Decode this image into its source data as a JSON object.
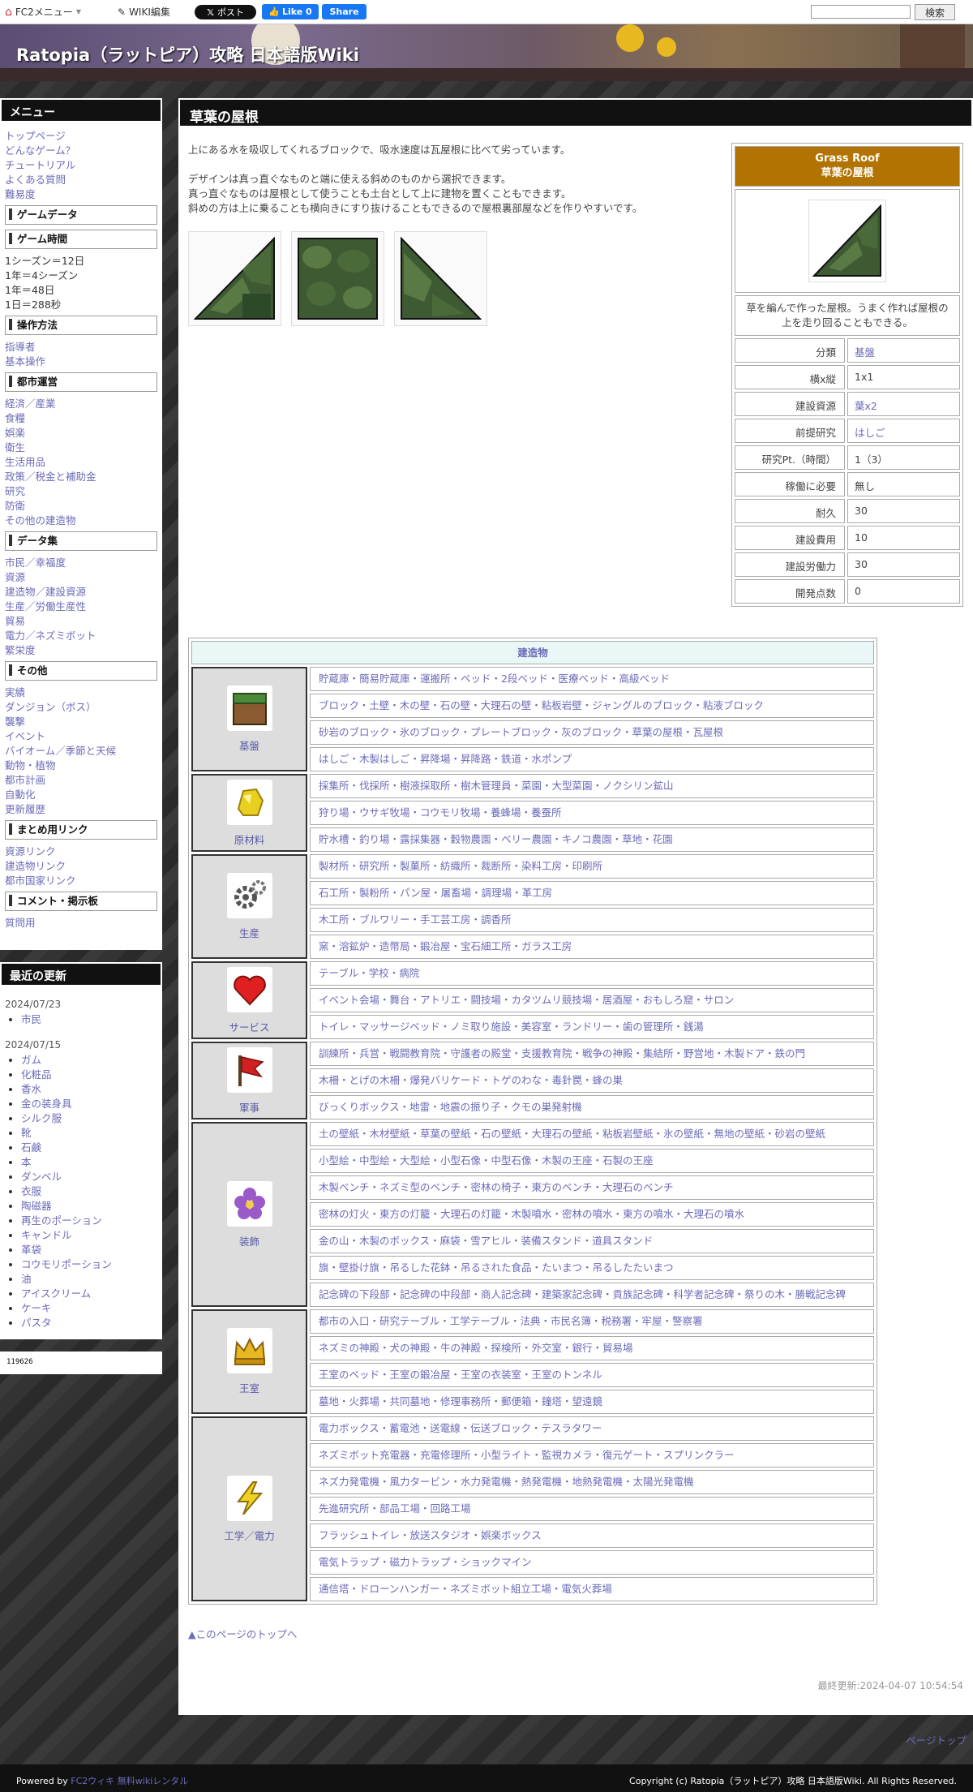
{
  "topbar": {
    "fc2_menu": "FC2メニュー",
    "wiki_edit": "WIKI編集",
    "x_post": "ポスト",
    "fb_like": "Like 0",
    "fb_share": "Share",
    "search_placeholder": "",
    "search_button": "検索"
  },
  "site": {
    "title": "Ratopia（ラットピア）攻略 日本語版Wiki"
  },
  "menu": {
    "title": "メニュー",
    "top_links": [
      "トップページ",
      "どんなゲーム？",
      "チュートリアル",
      "よくある質問",
      "難易度"
    ],
    "sections": [
      {
        "title": "ゲームデータ",
        "items": []
      },
      {
        "title": "ゲーム時間",
        "plain": [
          "1シーズン＝12日",
          "1年＝4シーズン",
          "1年＝48日",
          "1日＝288秒"
        ]
      },
      {
        "title": "操作方法",
        "items": [
          "指導者",
          "基本操作"
        ]
      },
      {
        "title": "都市運営",
        "items": [
          "経済／産業",
          "食糧",
          "娯楽",
          "衛生",
          "生活用品",
          "政策／税金と補助金",
          "研究",
          "防衛",
          "その他の建造物"
        ]
      },
      {
        "title": "データ集",
        "items": [
          "市民／幸福度",
          "資源",
          "建造物／建設資源",
          "生産／労働生産性",
          "貿易",
          "電力／ネズミボット",
          "繁栄度"
        ]
      },
      {
        "title": "その他",
        "items": [
          "実績",
          "ダンジョン（ボス）",
          "襲撃",
          "イベント",
          "バイオーム／季節と天候",
          "動物・植物",
          "都市計画",
          "自動化",
          "更新履歴"
        ]
      },
      {
        "title": "まとめ用リンク",
        "items": [
          "資源リンク",
          "建造物リンク",
          "都市国家リンク"
        ]
      },
      {
        "title": "コメント・掲示板",
        "items": [
          "質問用"
        ]
      }
    ]
  },
  "recent": {
    "title": "最近の更新",
    "groups": [
      {
        "date": "2024/07/23",
        "items": [
          "市民"
        ]
      },
      {
        "date": "2024/07/15",
        "items": [
          "ガム",
          "化粧品",
          "香水",
          "金の装身具",
          "シルク服",
          "靴",
          "石鹸",
          "本",
          "ダンベル",
          "衣服",
          "陶磁器",
          "再生のポーション",
          "キャンドル",
          "革袋",
          "コウモリポーション",
          "油",
          "アイスクリーム",
          "ケーキ",
          "パスタ"
        ]
      }
    ]
  },
  "counter": "119626",
  "page": {
    "title": "草葉の屋根",
    "intro": [
      "上にある水を吸収してくれるブロックで、吸水速度は瓦屋根に比べて劣っています。",
      "デザインは真っ直ぐなものと端に使える斜めのものから選択できます。",
      "真っ直ぐなものは屋根として使うことも土台として上に建物を置くこともできます。",
      "斜めの方は上に乗ることも横向きにすり抜けることもできるので屋根裏部屋などを作りやすいです。"
    ],
    "to_top": "▲このページのトップへ",
    "last_updated": "最終更新:2024-04-07 10:54:54"
  },
  "infobox": {
    "title_en": "Grass Roof",
    "title_ja": "草葉の屋根",
    "description": "草を編んで作った屋根。うまく作れば屋根の上を走り回ることもできる。",
    "rows": [
      {
        "key": "分類",
        "value": "基盤",
        "link": true
      },
      {
        "key": "横x縦",
        "value": "1x1",
        "link": false
      },
      {
        "key": "建設資源",
        "value": "葉x2",
        "link": true
      },
      {
        "key": "前提研究",
        "value": "はしご",
        "link": true
      },
      {
        "key": "研究Pt.（時間）",
        "value": "1（3）",
        "link": false
      },
      {
        "key": "稼働に必要",
        "value": "無し",
        "link": false
      },
      {
        "key": "耐久",
        "value": "30",
        "link": false
      },
      {
        "key": "建設費用",
        "value": "10",
        "link": false
      },
      {
        "key": "建設労働力",
        "value": "30",
        "link": false
      },
      {
        "key": "開発点数",
        "value": "0",
        "link": false
      }
    ]
  },
  "buildings": {
    "title": "建造物",
    "categories": [
      {
        "name": "基盤",
        "icon": "dirt-block-icon",
        "rows": [
          "貯蔵庫・簡易貯蔵庫・運搬所・ベッド・2段ベッド・医療ベッド・高級ベッド",
          "ブロック・土壁・木の壁・石の壁・大理石の壁・粘板岩壁・ジャングルのブロック・粘液ブロック",
          "砂岩のブロック・氷のブロック・プレートブロック・灰のブロック・草葉の屋根・瓦屋根",
          "はしご・木製はしご・昇降場・昇降路・鉄道・水ポンプ"
        ]
      },
      {
        "name": "原材料",
        "icon": "gold-ore-icon",
        "rows": [
          "採集所・伐採所・樹液採取所・樹木管理員・菜園・大型菜園・ノクシリン鉱山",
          "狩り場・ウサギ牧場・コウモリ牧場・養蜂場・養蚕所",
          "貯水槽・釣り場・露採集器・穀物農園・ベリー農園・キノコ農園・草地・花園"
        ]
      },
      {
        "name": "生産",
        "icon": "gears-icon",
        "rows": [
          "製材所・研究所・製菓所・紡織所・裁断所・染料工房・印刷所",
          "石工所・製粉所・パン屋・屠畜場・調理場・革工房",
          "木工所・ブルワリー・手工芸工房・調香所",
          "窯・溶鉱炉・造幣局・鍛冶屋・宝石細工所・ガラス工房"
        ]
      },
      {
        "name": "サービス",
        "icon": "heart-icon",
        "rows": [
          "テーブル・学校・病院",
          "イベント会場・舞台・アトリエ・闘技場・カタツムリ競技場・居酒屋・おもしろ窟・サロン",
          "トイレ・マッサージベッド・ノミ取り施設・美容室・ランドリー・歯の管理所・銭湯"
        ]
      },
      {
        "name": "軍事",
        "icon": "flag-icon",
        "rows": [
          "訓練所・兵営・戦闘教育院・守護者の殿堂・支援教育院・戦争の神殿・集結所・野営地・木製ドア・鉄の門",
          "木柵・とげの木柵・爆発バリケード・トゲのわな・毒針罠・蜂の巣",
          "びっくりボックス・地雷・地震の振り子・クモの巣発射機"
        ]
      },
      {
        "name": "装飾",
        "icon": "flower-icon",
        "rows": [
          "土の壁紙・木材壁紙・草葉の壁紙・石の壁紙・大理石の壁紙・粘板岩壁紙・氷の壁紙・無地の壁紙・砂岩の壁紙",
          "小型絵・中型絵・大型絵・小型石像・中型石像・木製の王座・石製の王座",
          "木製ベンチ・ネズミ型のベンチ・密林の椅子・東方のベンチ・大理石のベンチ",
          "密林の灯火・東方の灯籠・大理石の灯籠・木製噴水・密林の噴水・東方の噴水・大理石の噴水",
          "金の山・木製のボックス・麻袋・雪アヒル・装備スタンド・道具スタンド",
          "旗・壁掛け旗・吊るした花鉢・吊るされた食品・たいまつ・吊るしたたいまつ",
          "記念碑の下段部・記念碑の中段部・商人記念碑・建築家記念碑・貢族記念碑・科学者記念碑・祭りの木・勝戦記念碑"
        ]
      },
      {
        "name": "王室",
        "icon": "crown-icon",
        "rows": [
          "都市の入口・研究テーブル・工学テーブル・法典・市民名簿・税務署・牢屋・警察署",
          "ネズミの神殿・犬の神殿・牛の神殿・探検所・外交室・銀行・貿易場",
          "王室のベッド・王室の鍛冶屋・王室の衣装室・王室のトンネル",
          "墓地・火葬場・共同墓地・修理事務所・郵便箱・鐘塔・望遠鏡"
        ]
      },
      {
        "name": "工学／電力",
        "icon": "lightning-icon",
        "rows": [
          "電力ボックス・蓄電池・送電線・伝送ブロック・テスラタワー",
          "ネズミボット充電器・充電修理所・小型ライト・監視カメラ・復元ゲート・スプリンクラー",
          "ネズ力発電機・風力タービン・水力発電機・熱発電機・地熱発電機・太陽光発電機",
          "先進研究所・部品工場・回路工場",
          "フラッシュトイレ・放送スタジオ・娯楽ボックス",
          "電気トラップ・磁力トラップ・ショックマイン",
          "通信塔・ドローンハンガー・ネズミボット組立工場・電気火葬場"
        ]
      }
    ]
  },
  "footer": {
    "powered_by": "Powered by",
    "fc2_wiki": "FC2ウィキ",
    "free_wiki": "無料wikiレンタル",
    "copyright": "Copyright (c) Ratopia（ラットピア）攻略 日本語版Wiki. All Rights Reserved.",
    "page_top": "ページトップ"
  }
}
